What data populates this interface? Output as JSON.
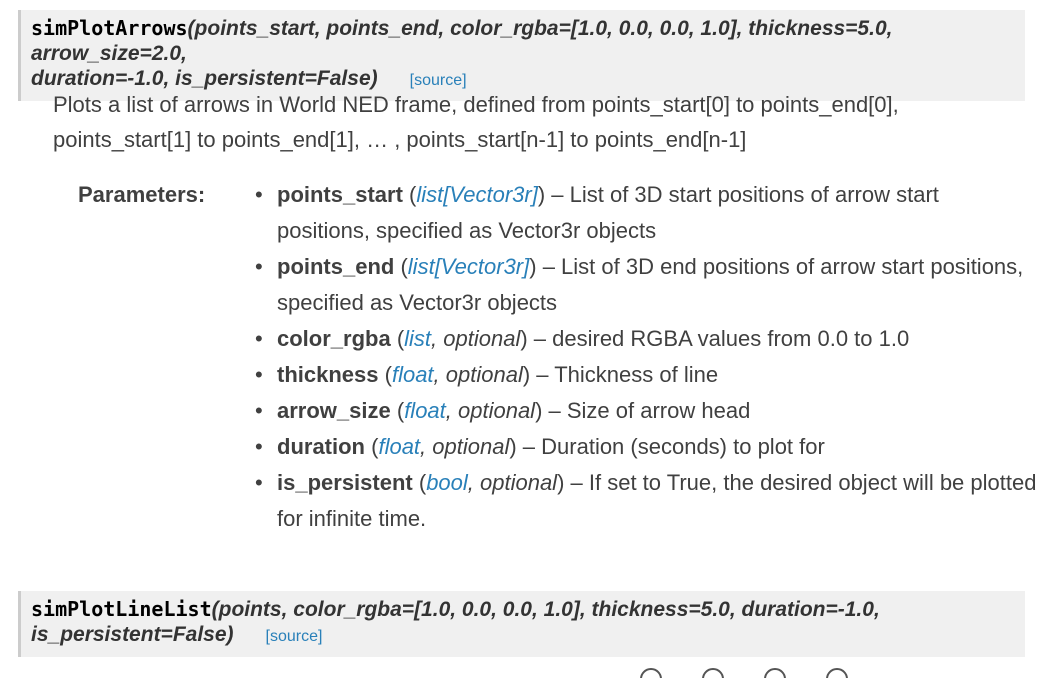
{
  "sig1": {
    "name": "simPlotArrows",
    "params_line1": "(points_start, points_end, color_rgba=[1.0, 0.0, 0.0, 1.0], thickness=5.0, arrow_size=2.0,",
    "params_line2": "duration=-1.0, is_persistent=False)",
    "source": "[source]"
  },
  "description": {
    "line1": "Plots a list of arrows in World NED frame, defined from points_start[0] to points_end[0],",
    "line2": "points_start[1] to points_end[1], … , points_start[n-1] to points_end[n-1]"
  },
  "parameters_label": "Parameters:",
  "parameters": [
    {
      "name": "points_start",
      "open": " (",
      "type": "list",
      "type2": "[Vector3r]",
      "close": ")",
      "sep": " – ",
      "desc": "List of 3D start positions of arrow start positions, specified as Vector3r objects"
    },
    {
      "name": "points_end",
      "open": " (",
      "type": "list",
      "type2": "[Vector3r]",
      "close": ")",
      "sep": " – ",
      "desc": "List of 3D end positions of arrow start positions, specified as Vector3r objects"
    },
    {
      "name": "color_rgba",
      "open": " (",
      "type": "list",
      "opt": ", optional",
      "close": ")",
      "sep": " – ",
      "desc": "desired RGBA values from 0.0 to 1.0"
    },
    {
      "name": "thickness",
      "open": " (",
      "type": "float",
      "opt": ", optional",
      "close": ")",
      "sep": " – ",
      "desc": "Thickness of line"
    },
    {
      "name": "arrow_size",
      "open": " (",
      "type": "float",
      "opt": ", optional",
      "close": ")",
      "sep": " – ",
      "desc": "Size of arrow head"
    },
    {
      "name": "duration",
      "open": " (",
      "type": "float",
      "opt": ", optional",
      "close": ")",
      "sep": " – ",
      "desc": "Duration (seconds) to plot for"
    },
    {
      "name": "is_persistent",
      "open": " (",
      "type": "bool",
      "opt": ", optional",
      "close": ")",
      "sep": " – ",
      "desc": "If set to True, the desired object will be plotted for infinite time."
    }
  ],
  "sig2": {
    "name": "simPlotLineList",
    "params_line1": "(points, color_rgba=[1.0, 0.0, 0.0, 1.0], thickness=5.0, duration=-1.0,",
    "params_line2": "is_persistent=False)",
    "source": "[source]"
  }
}
